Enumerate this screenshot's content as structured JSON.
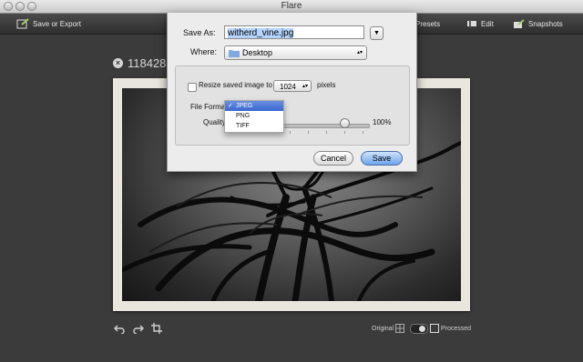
{
  "window": {
    "title": "Flare"
  },
  "toolbar": {
    "save_export_label": "Save or Export",
    "presets_label": "Presets",
    "edit_label": "Edit",
    "snapshots_label": "Snapshots"
  },
  "content": {
    "file_info_partial": "118428"
  },
  "bottom_bar": {
    "original_label": "Original",
    "processed_label": "Processed"
  },
  "save_dialog": {
    "save_as_label": "Save As:",
    "filename_value": "witherd_vine.jpg",
    "where_label": "Where:",
    "where_value": "Desktop",
    "resize_label": "Resize saved image to",
    "resize_value": "1024",
    "resize_unit": "pixels",
    "file_format_label": "File Format",
    "quality_label": "Quality",
    "quality_value": "100%",
    "quality_level": 0.72,
    "cancel_label": "Cancel",
    "save_label": "Save",
    "format_options": [
      "JPEG",
      "PNG",
      "TIFF"
    ],
    "format_selected": "JPEG",
    "format_check": "✓"
  }
}
